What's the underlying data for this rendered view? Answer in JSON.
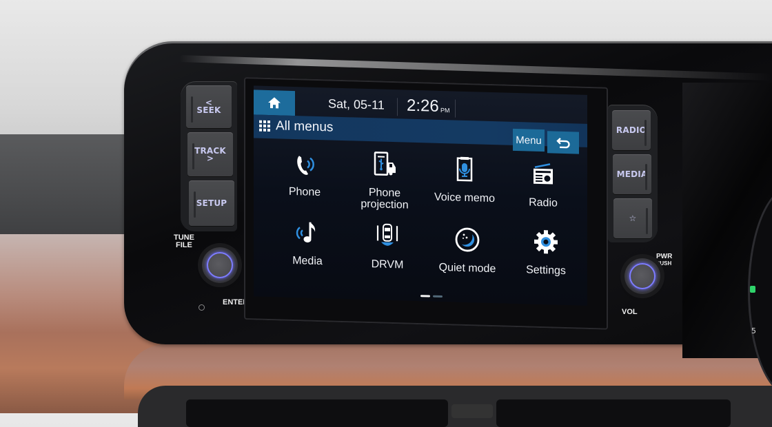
{
  "screen": {
    "status_bar": {
      "date": "Sat, 05-11",
      "time": "2:26",
      "ampm": "PM"
    },
    "title_bar": {
      "title": "All menus",
      "menu_label": "Menu"
    },
    "tiles": [
      {
        "label": "Phone",
        "icon": "phone-icon"
      },
      {
        "label": "Phone\nprojection",
        "label_line1": "Phone",
        "label_line2": "projection",
        "icon": "phone-projection-icon"
      },
      {
        "label": "Voice memo",
        "icon": "voice-memo-icon"
      },
      {
        "label": "Radio",
        "icon": "radio-icon"
      },
      {
        "label": "Media",
        "icon": "media-icon"
      },
      {
        "label": "DRVM",
        "icon": "drvm-icon"
      },
      {
        "label": "Quiet mode",
        "icon": "quiet-mode-icon"
      },
      {
        "label": "Settings",
        "icon": "settings-icon"
      }
    ],
    "pagination": {
      "current_page": 1,
      "total_pages": 2
    }
  },
  "hardware": {
    "left_buttons": [
      {
        "label": "SEEK",
        "arrow": "<"
      },
      {
        "label": "TRACK",
        "arrow": ">"
      },
      {
        "label": "SETUP"
      }
    ],
    "right_buttons": [
      {
        "label": "RADIO"
      },
      {
        "label": "MEDIA"
      },
      {
        "label": "☆"
      }
    ],
    "tune_label_1": "TUNE",
    "tune_label_2": "FILE",
    "enter_label": "ENTER",
    "pwr_label": "PWR",
    "push_label": "PUSH",
    "vol_label": "VOL"
  },
  "colors": {
    "accent_blue": "#1d6c9c",
    "title_bar": "#13375e",
    "icon_blue": "#2f8fe0",
    "knob_ring": "#7d7cff"
  }
}
